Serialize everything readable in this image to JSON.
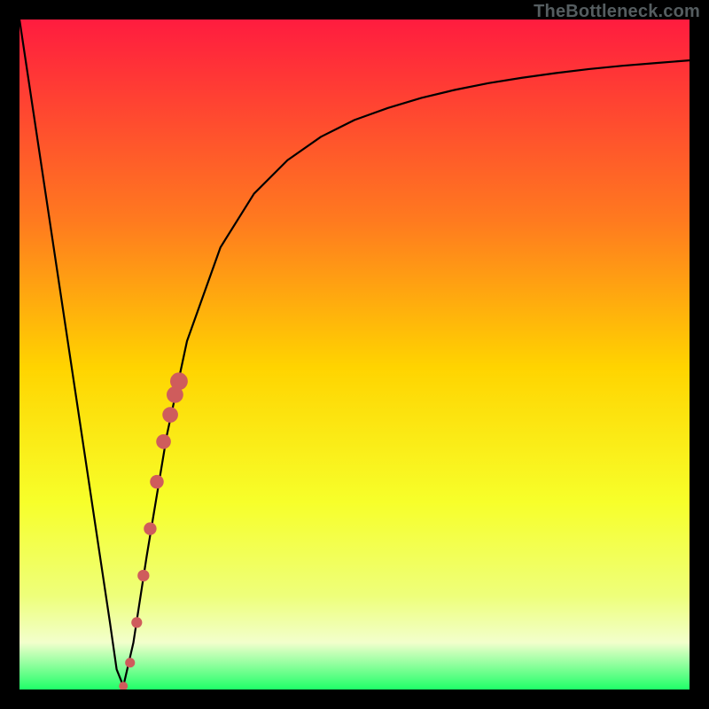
{
  "watermark": "TheBottleneck.com",
  "colors": {
    "frame": "#000000",
    "gradient_top": "#ff1c3f",
    "gradient_mid_upper": "#ff7a1f",
    "gradient_mid": "#ffd400",
    "gradient_mid_lower": "#f7ff2a",
    "gradient_lower": "#eeff7a",
    "gradient_pale": "#f2ffcc",
    "gradient_bottom": "#1fff68",
    "curve": "#000000",
    "marker": "#cf5c5c"
  },
  "chart_data": {
    "type": "line",
    "title": "",
    "xlabel": "",
    "ylabel": "",
    "xlim": [
      0,
      100
    ],
    "ylim": [
      0,
      100
    ],
    "series": [
      {
        "name": "bottleneck-curve",
        "x": [
          0,
          3,
          6,
          9,
          12,
          13.5,
          14.5,
          15.5,
          17,
          19,
          22,
          25,
          30,
          35,
          40,
          45,
          50,
          55,
          60,
          65,
          70,
          75,
          80,
          85,
          90,
          95,
          100
        ],
        "values": [
          100,
          80,
          60,
          40,
          20,
          10,
          3,
          0.5,
          7,
          20,
          38,
          52,
          66,
          74,
          79,
          82.5,
          85,
          86.8,
          88.3,
          89.5,
          90.5,
          91.3,
          92,
          92.6,
          93.1,
          93.5,
          93.9
        ]
      }
    ],
    "markers": {
      "name": "highlight-dots",
      "x": [
        15.5,
        16.5,
        17.5,
        18.5,
        19.5,
        20.5,
        21.5,
        22.5,
        23.2,
        23.8
      ],
      "values": [
        0.5,
        4,
        10,
        17,
        24,
        31,
        37,
        41,
        44,
        46
      ]
    }
  }
}
